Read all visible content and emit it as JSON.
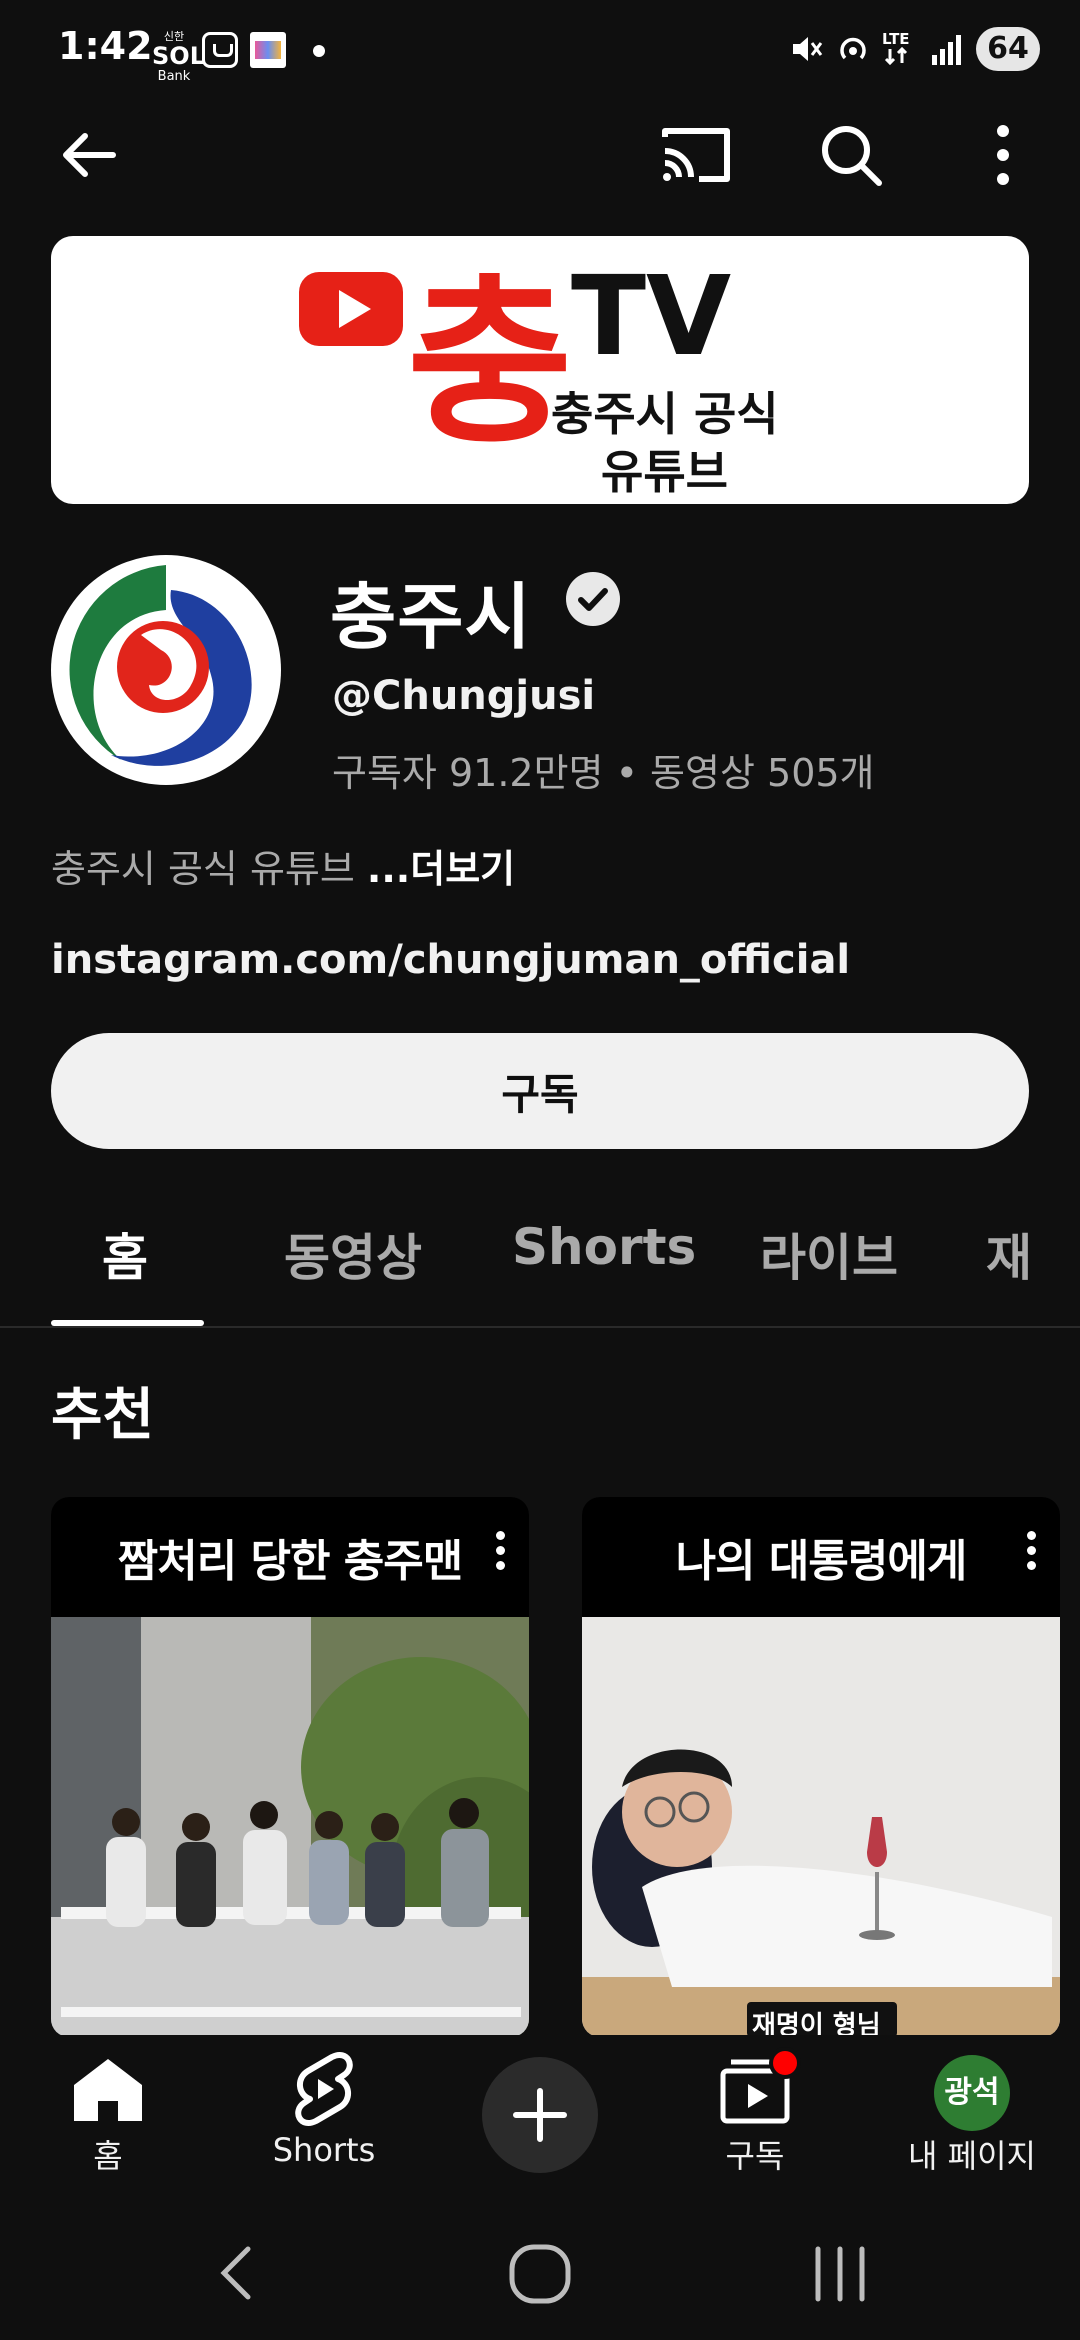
{
  "status_bar": {
    "time": "1:42",
    "sol_top": "신한",
    "sol_logo": "SOL",
    "sol_sub": "Bank",
    "network": "LTE",
    "battery": "64"
  },
  "channel": {
    "name": "충주시",
    "handle": "@Chungjusi",
    "stats": "구독자 91.2만명 • 동영상 505개",
    "description": "충주시 공식 유튜브 ",
    "more_label": "...더보기",
    "link": "instagram.com/chungjuman_official",
    "subscribe_label": "구독"
  },
  "banner": {
    "logo_char": "충",
    "logo_tv": "TV",
    "line1": "충주시 공식",
    "line2": "유튜브",
    "brand_color": "#e62117"
  },
  "tabs": [
    {
      "label": "홈",
      "active": true
    },
    {
      "label": "동영상",
      "active": false
    },
    {
      "label": "Shorts",
      "active": false
    },
    {
      "label": "라이브",
      "active": false
    },
    {
      "label": "재",
      "active": false
    }
  ],
  "section": {
    "title": "추천"
  },
  "shorts": [
    {
      "title": "짬처리 당한 충주맨"
    },
    {
      "title": "나의 대통령에게",
      "caption": "재명이 형님"
    }
  ],
  "bottom_nav": {
    "home": "홈",
    "shorts": "Shorts",
    "subscriptions": "구독",
    "me": "내 페이지",
    "me_avatar_text": "광석"
  }
}
